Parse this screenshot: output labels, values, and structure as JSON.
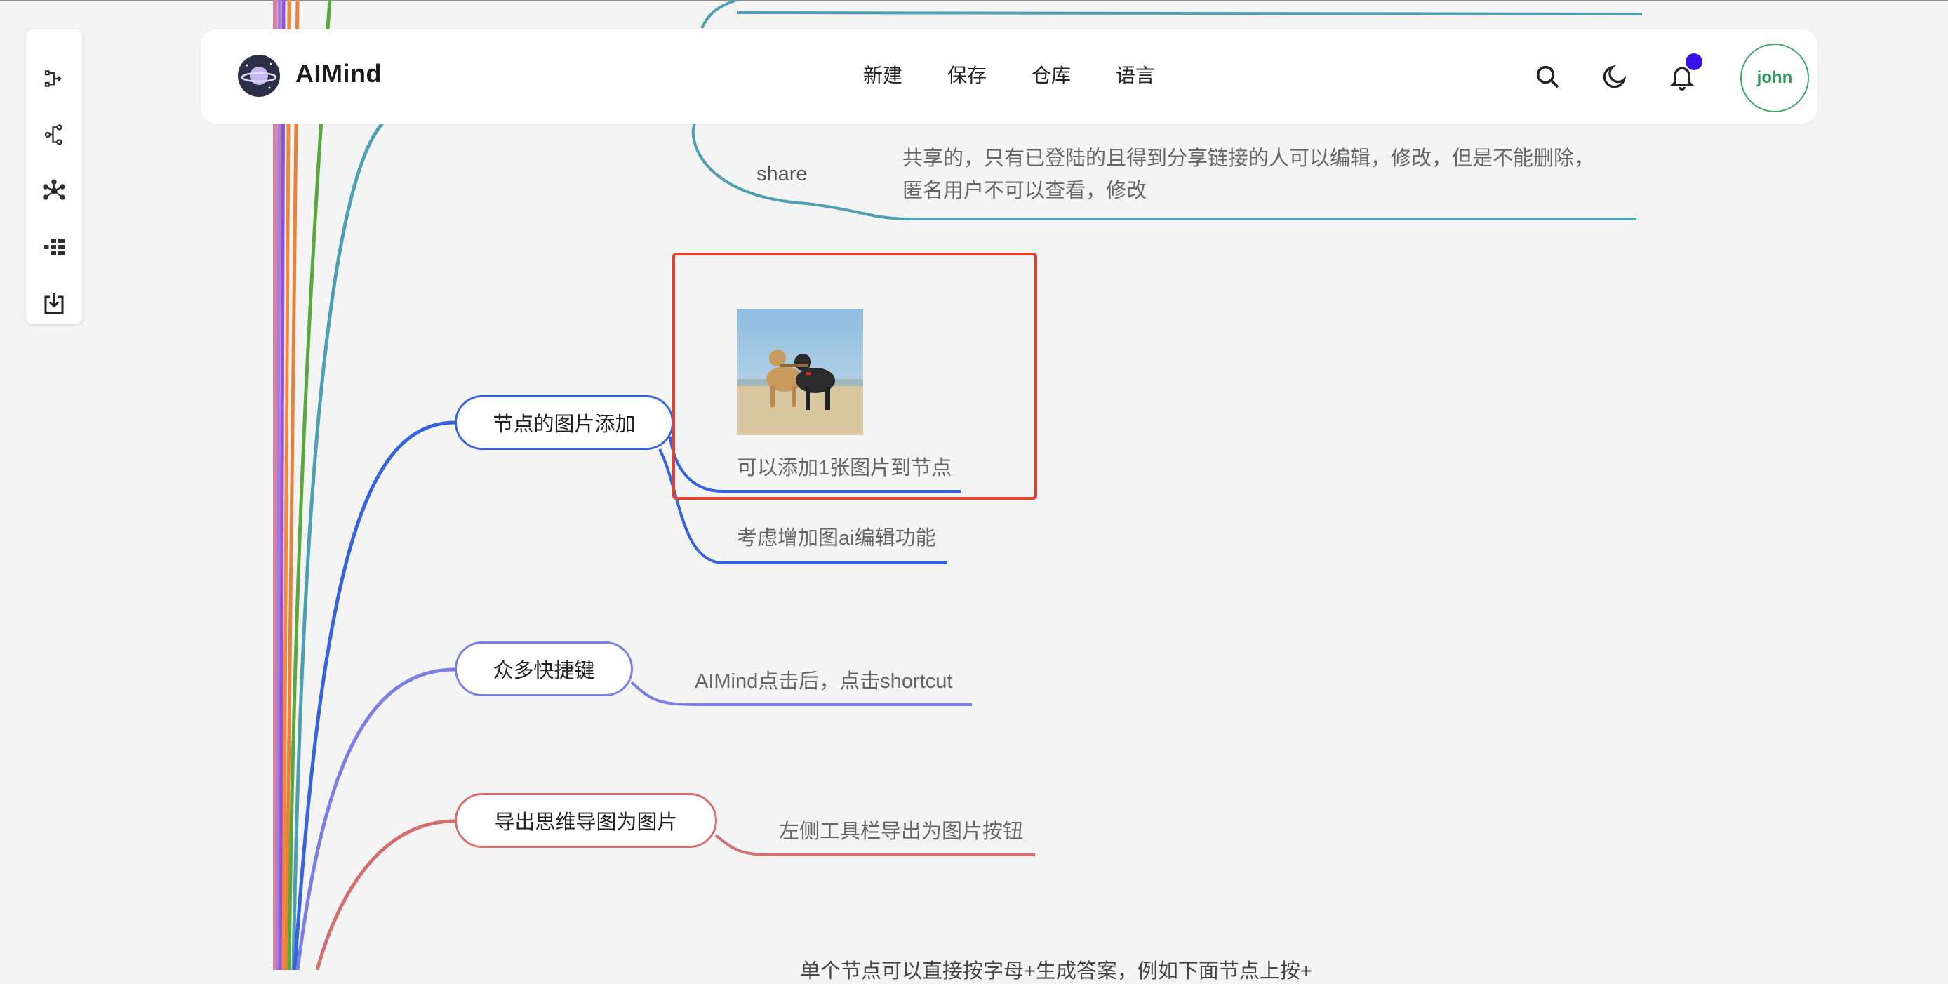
{
  "app": {
    "name": "AIMind"
  },
  "header": {
    "nav": [
      "新建",
      "保存",
      "仓库",
      "语言"
    ],
    "user": "john",
    "icons": [
      "search-icon",
      "moon-icon",
      "bell-icon"
    ]
  },
  "toolbar": {
    "tools": [
      "layout-right-icon",
      "layout-tree-icon",
      "layout-radial-icon",
      "layout-org-icon",
      "export-icon"
    ]
  },
  "mindmap": {
    "share_label": "share",
    "share_text_line1": "共享的，只有已登陆的且得到分享链接的人可以编辑，修改，但是不能删除，",
    "share_text_line2": "匿名用户不可以查看，修改",
    "image_node": {
      "title": "节点的图片添加",
      "child1": "可以添加1张图片到节点",
      "child2": "考虑增加图ai编辑功能"
    },
    "shortcut_node": {
      "title": "众多快捷键",
      "child": "AIMind点击后，点击shortcut"
    },
    "export_node": {
      "title": "导出思维导图为图片",
      "child": "左侧工具栏导出为图片按钮"
    },
    "clipped_text": "单个节点可以直接按字母+生成答案，例如下面节点上按+"
  },
  "colors": {
    "teal": "#4e9fb3",
    "blue": "#3563e0",
    "periwinkle": "#7a7fe6",
    "salmon": "#d36f6f",
    "selection": "#e0412d",
    "avatar": "#3ea86a",
    "notification": "#3a10e8"
  }
}
